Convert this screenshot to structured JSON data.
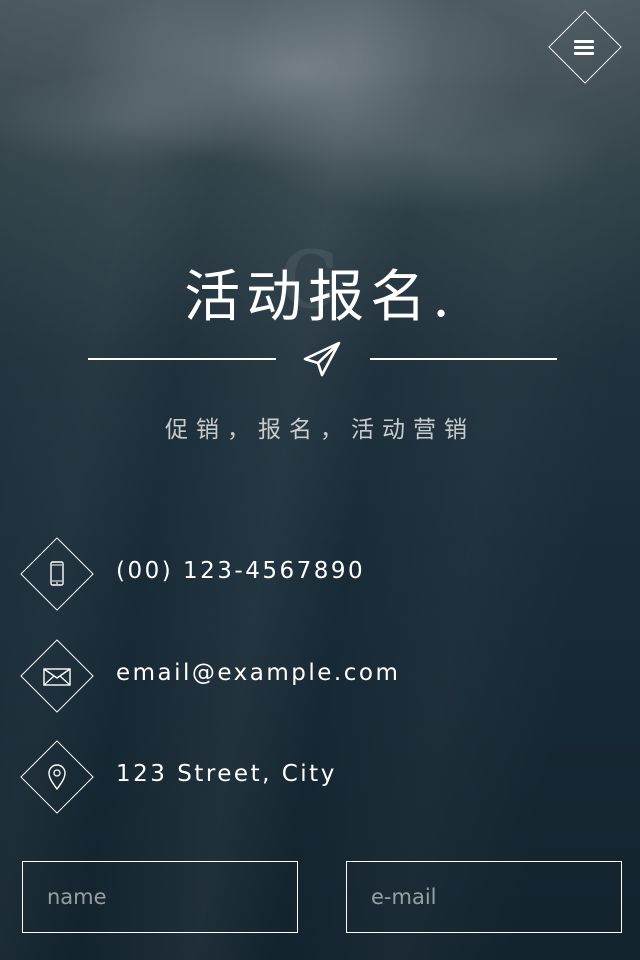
{
  "header": {
    "menu_icon": "menu-icon"
  },
  "hero": {
    "watermark": "c",
    "title": "活动报名.",
    "divider_icon": "paper-plane-icon",
    "subtitle": "促销，报名，活动营销"
  },
  "contacts": [
    {
      "icon": "phone-icon",
      "text": "(00) 123-4567890"
    },
    {
      "icon": "envelope-icon",
      "text": "email@example.com"
    },
    {
      "icon": "location-pin-icon",
      "text": "123 Street, City"
    }
  ],
  "form": {
    "name_placeholder": "name",
    "email_placeholder": "e-mail"
  }
}
